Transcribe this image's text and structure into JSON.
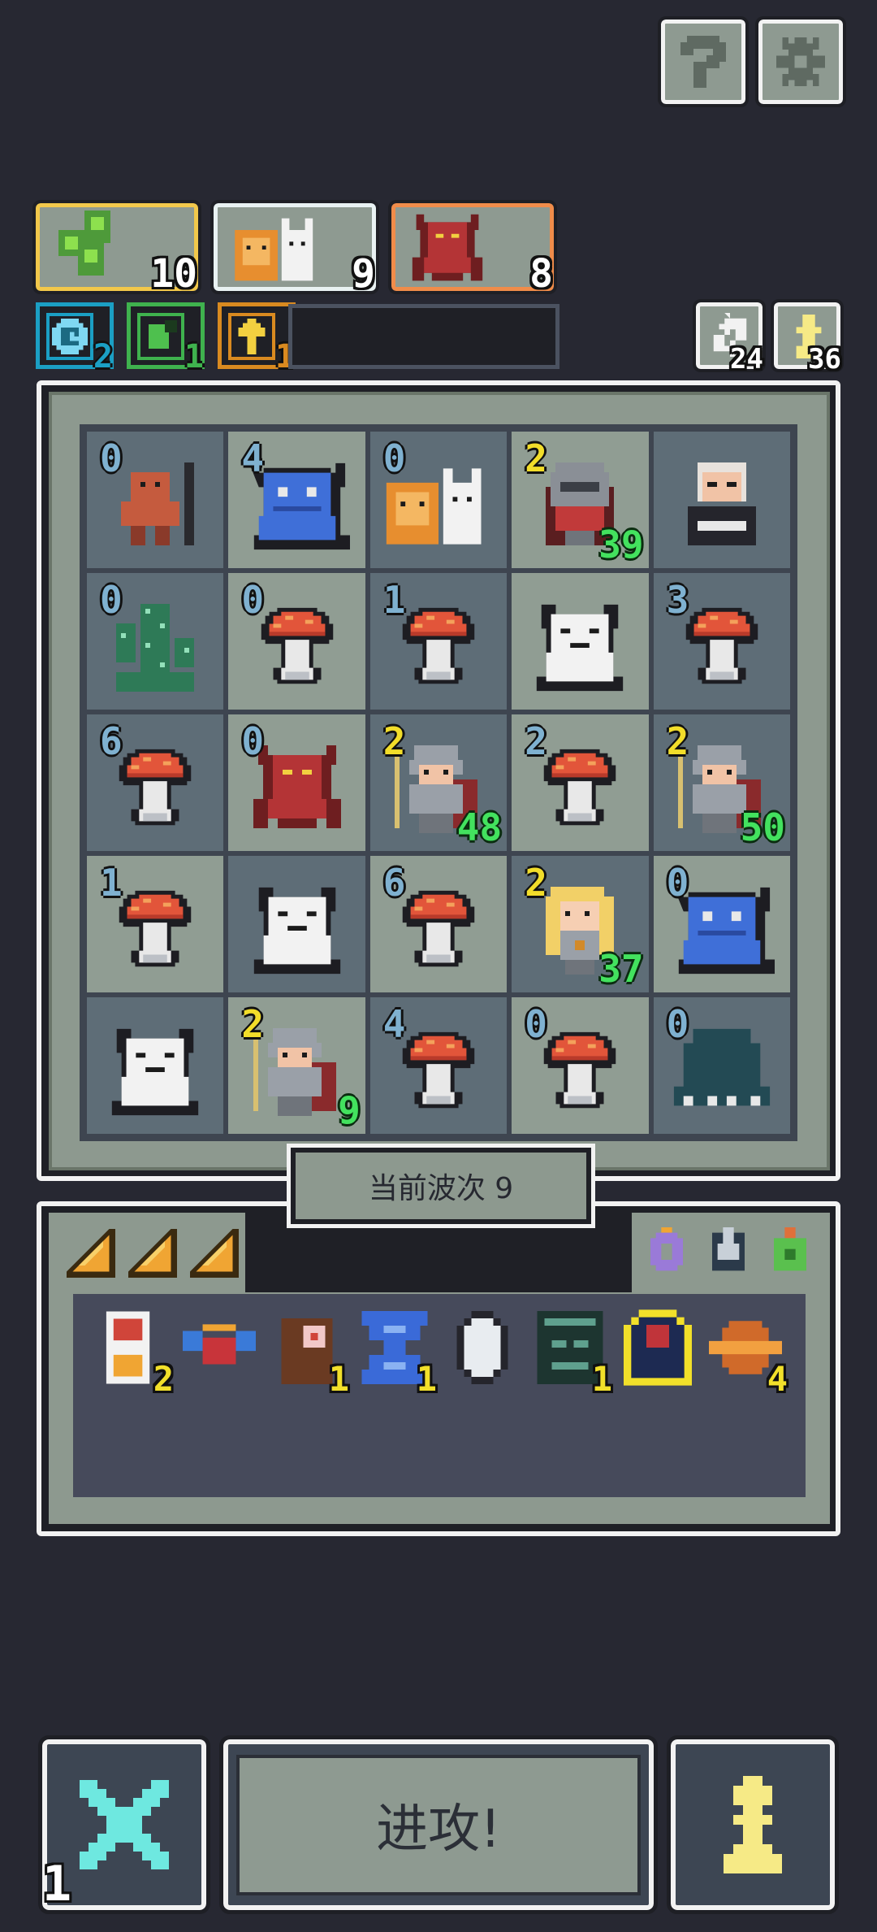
{
  "top_buttons": {
    "help_icon": "question-mark-icon",
    "settings_icon": "gear-icon"
  },
  "synergies": [
    {
      "name": "slime",
      "count": "10",
      "border": "#f2c84b"
    },
    {
      "name": "beast-duo",
      "count": "9",
      "border": "#e9f2f2"
    },
    {
      "name": "demon",
      "count": "8",
      "border": "#f08c4a"
    }
  ],
  "resources": [
    {
      "name": "clock",
      "count": "2",
      "color": "#1b9fc4"
    },
    {
      "name": "green-orb",
      "count": "1",
      "color": "#3fb24e"
    },
    {
      "name": "upgrade-arrow",
      "count": "1",
      "color": "#d98a20"
    }
  ],
  "counters": {
    "refresh": "24",
    "pawn": "36"
  },
  "board": [
    [
      {
        "lvl": "0",
        "lc": "blue",
        "unit": "orc",
        "tone": "dark"
      },
      {
        "lvl": "4",
        "lc": "blue",
        "unit": "blue-demon",
        "tone": "light"
      },
      {
        "lvl": "0",
        "lc": "blue",
        "unit": "beast-duo",
        "tone": "dark"
      },
      {
        "lvl": "2",
        "lc": "yellow",
        "unit": "knight",
        "hp": "39",
        "tone": "light"
      },
      {
        "lvl": "",
        "lc": "blue",
        "unit": "old-man",
        "tone": "dark"
      }
    ],
    [
      {
        "lvl": "0",
        "lc": "blue",
        "unit": "cactus",
        "tone": "dark"
      },
      {
        "lvl": "0",
        "lc": "blue",
        "unit": "mushroom",
        "tone": "light"
      },
      {
        "lvl": "1",
        "lc": "blue",
        "unit": "mushroom",
        "tone": "dark"
      },
      {
        "lvl": "",
        "lc": "blue",
        "unit": "white-wolf",
        "tone": "light"
      },
      {
        "lvl": "3",
        "lc": "blue",
        "unit": "mushroom",
        "tone": "dark"
      }
    ],
    [
      {
        "lvl": "6",
        "lc": "blue",
        "unit": "mushroom",
        "tone": "dark"
      },
      {
        "lvl": "0",
        "lc": "blue",
        "unit": "demon",
        "tone": "light"
      },
      {
        "lvl": "2",
        "lc": "yellow",
        "unit": "soldier",
        "hp": "48",
        "tone": "dark"
      },
      {
        "lvl": "2",
        "lc": "blue",
        "unit": "mushroom",
        "tone": "light"
      },
      {
        "lvl": "2",
        "lc": "yellow",
        "unit": "soldier",
        "hp": "50",
        "tone": "dark"
      }
    ],
    [
      {
        "lvl": "1",
        "lc": "blue",
        "unit": "mushroom",
        "tone": "light"
      },
      {
        "lvl": "",
        "lc": "blue",
        "unit": "white-wolf",
        "tone": "dark"
      },
      {
        "lvl": "6",
        "lc": "blue",
        "unit": "mushroom",
        "tone": "light"
      },
      {
        "lvl": "2",
        "lc": "yellow",
        "unit": "blonde-hero",
        "hp": "37",
        "tone": "dark"
      },
      {
        "lvl": "0",
        "lc": "blue",
        "unit": "blue-demon",
        "tone": "light"
      }
    ],
    [
      {
        "lvl": "",
        "lc": "blue",
        "unit": "white-wolf",
        "tone": "dark"
      },
      {
        "lvl": "2",
        "lc": "yellow",
        "unit": "soldier",
        "hp": "9",
        "tone": "light"
      },
      {
        "lvl": "4",
        "lc": "blue",
        "unit": "mushroom",
        "tone": "dark"
      },
      {
        "lvl": "0",
        "lc": "blue",
        "unit": "mushroom",
        "tone": "light"
      },
      {
        "lvl": "0",
        "lc": "blue",
        "unit": "slime-paw",
        "tone": "dark"
      }
    ]
  ],
  "wave_label": "当前波次 9",
  "cards": [
    "card",
    "card",
    "card"
  ],
  "orbs": [
    "purple-ring",
    "grey-gem",
    "green-amulet"
  ],
  "items": [
    {
      "name": "potion-book",
      "count": "2"
    },
    {
      "name": "winged-orb",
      "count": ""
    },
    {
      "name": "brown-totem",
      "count": "1"
    },
    {
      "name": "hourglass",
      "count": "1"
    },
    {
      "name": "silver-egg",
      "count": ""
    },
    {
      "name": "dark-box",
      "count": "1"
    },
    {
      "name": "red-orb",
      "count": ""
    },
    {
      "name": "ring-planet",
      "count": "4"
    }
  ],
  "bottom": {
    "cancel_count": "1",
    "attack_label": "进攻!",
    "pawn_icon": "pawn-icon",
    "cancel_icon": "cross-icon"
  }
}
